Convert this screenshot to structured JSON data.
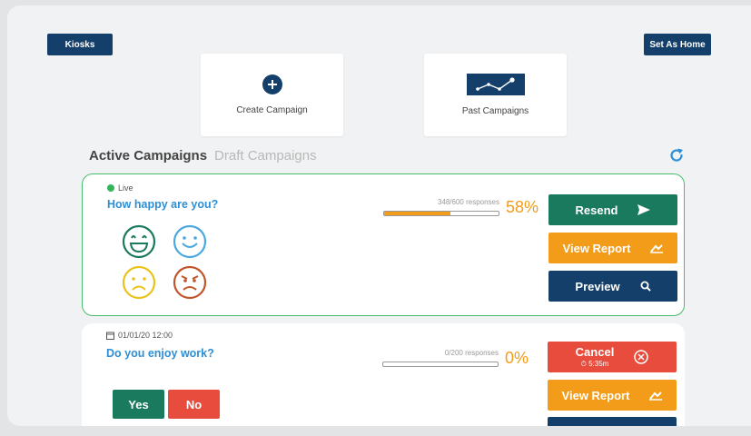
{
  "header": {
    "kiosks_label": "Kiosks",
    "set_home_label": "Set As Home"
  },
  "tiles": [
    {
      "label": "Create Campaign",
      "icon": "plus-circle-icon"
    },
    {
      "label": "Past Campaigns",
      "icon": "line-chart-icon"
    }
  ],
  "tabs": {
    "active": "Active Campaigns",
    "draft": "Draft Campaigns"
  },
  "refresh_icon": "refresh-icon",
  "campaigns": [
    {
      "status": "Live",
      "question": "How happy are you?",
      "responses": "348/600 responses",
      "progress": 0.58,
      "percent": "58%",
      "actions": [
        "Resend",
        "View Report",
        "Preview"
      ],
      "smileys": [
        "very-happy",
        "happy",
        "sad",
        "angry"
      ]
    },
    {
      "date": "01/01/20 12:00",
      "question": "Do you enjoy work?",
      "responses": "0/200 responses",
      "progress": 0,
      "percent": "0%",
      "cancel_label": "Cancel",
      "countdown": "5:35m",
      "view_report": "View Report",
      "options": [
        "Yes",
        "No"
      ]
    }
  ],
  "colors": {
    "navy": "#143f6b",
    "green": "#1a7a5e",
    "orange": "#f39c19",
    "red": "#e74c3c",
    "live_border": "#45bd6a",
    "question_blue": "#2d8fd6"
  }
}
